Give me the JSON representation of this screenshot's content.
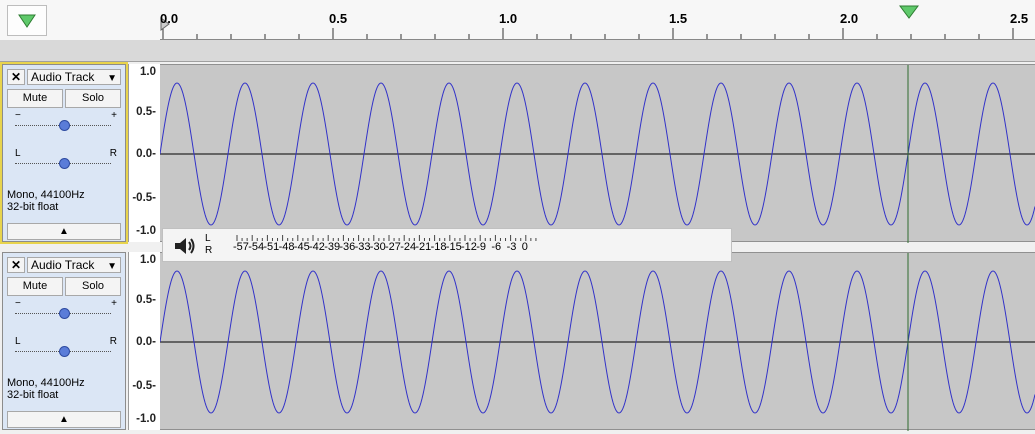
{
  "toolbar": {
    "play_head_icon": "green-triangle-down-icon"
  },
  "ruler": {
    "labels": [
      "0.0",
      "0.5",
      "1.0",
      "1.5",
      "2.0",
      "2.5"
    ],
    "marker_icon": "green-triangle-down-icon"
  },
  "tracks": [
    {
      "close_label": "✕",
      "name": "Audio Track",
      "mute_label": "Mute",
      "solo_label": "Solo",
      "gain_minus": "−",
      "gain_plus": "+",
      "pan_left": "L",
      "pan_right": "R",
      "info_line1": "Mono, 44100Hz",
      "info_line2": "32-bit float",
      "collapse_icon": "triangle-up-icon",
      "scale": [
        "1.0",
        "0.5-",
        "0.0-",
        "-0.5-",
        "-1.0"
      ]
    },
    {
      "close_label": "✕",
      "name": "Audio Track",
      "mute_label": "Mute",
      "solo_label": "Solo",
      "gain_minus": "−",
      "gain_plus": "+",
      "pan_left": "L",
      "pan_right": "R",
      "info_line1": "Mono, 44100Hz",
      "info_line2": "32-bit float",
      "collapse_icon": "triangle-up-icon",
      "scale": [
        "1.0",
        "0.5-",
        "0.0-",
        "-0.5-",
        "-1.0"
      ]
    }
  ],
  "meter": {
    "icon": "speaker-icon",
    "channel_left": "L",
    "channel_right": "R",
    "scale": [
      "-57",
      "-54",
      "-51",
      "-48",
      "-45",
      "-42",
      "-39",
      "-36",
      "-33",
      "-30",
      "-27",
      "-24",
      "-21",
      "-18",
      "-15",
      "-12",
      "-9",
      "-6",
      "-3",
      "0"
    ]
  },
  "colors": {
    "waveform": "#3232c8",
    "wave_bg": "#c7c7c7",
    "cursor_line": "#2f6b2f",
    "marker": "#5fc96b",
    "selected_outline": "#e8d44d"
  }
}
